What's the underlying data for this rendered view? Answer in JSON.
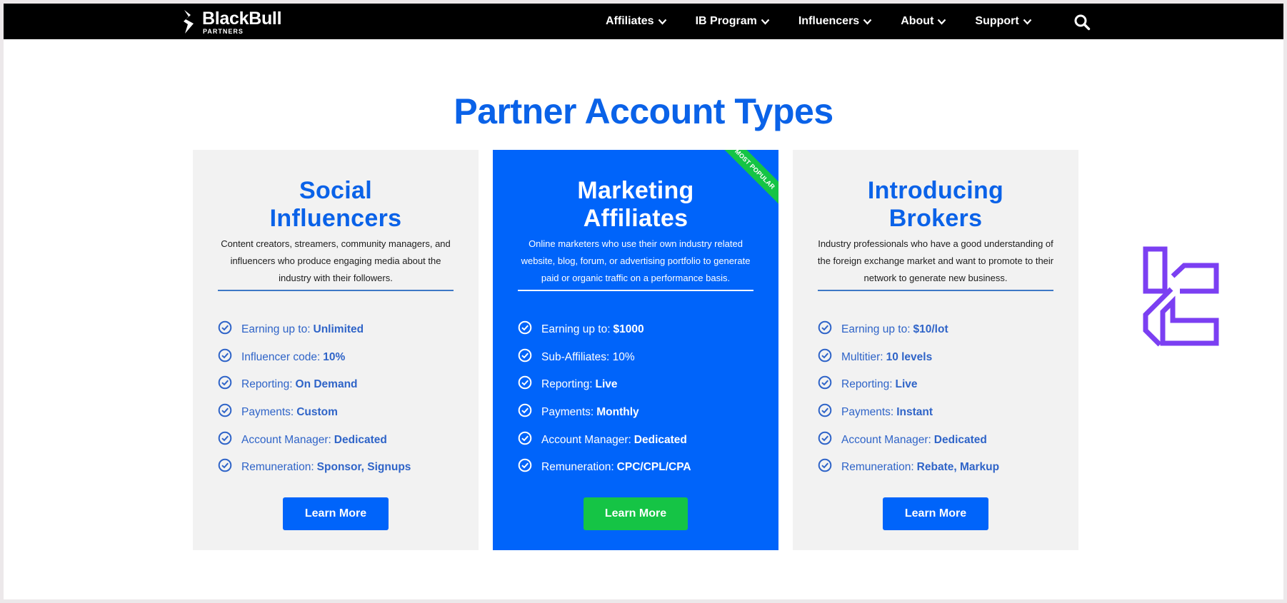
{
  "brand": {
    "name": "BlackBull",
    "subtitle": "PARTNERS"
  },
  "nav": {
    "items": [
      {
        "label": "Affiliates",
        "icon": "chevron-down-icon"
      },
      {
        "label": "IB Program",
        "icon": "chevron-down-icon"
      },
      {
        "label": "Influencers",
        "icon": "chevron-down-icon"
      },
      {
        "label": "About",
        "icon": "chevron-down-icon"
      },
      {
        "label": "Support",
        "icon": "chevron-down-icon"
      }
    ],
    "search_icon": "search-icon"
  },
  "page": {
    "title": "Partner Account Types"
  },
  "colors": {
    "brand_blue": "#0064fa",
    "title_blue": "#0a62e8",
    "accent_green": "#15c445",
    "card_bg": "#f2f2f2",
    "watermark_purple": "#7b3ff2"
  },
  "cards": [
    {
      "title_line1": "Social",
      "title_line2": "Influencers",
      "description": "Content creators, streamers, community managers, and influencers who produce engaging media about the industry with their followers.",
      "features": [
        {
          "label": "Earning up to:",
          "value": "Unlimited"
        },
        {
          "label": "Influencer code:",
          "value": "10%"
        },
        {
          "label": "Reporting:",
          "value": "On Demand"
        },
        {
          "label": "Payments:",
          "value": "Custom"
        },
        {
          "label": "Account Manager:",
          "value": "Dedicated"
        },
        {
          "label": "Remuneration:",
          "value": "Sponsor, Signups"
        }
      ],
      "button": "Learn More"
    },
    {
      "title_line1": "Marketing",
      "title_line2": "Affiliates",
      "badge": "MOST POPULAR",
      "description": "Online marketers who use their own industry related website, blog, forum, or advertising portfolio to generate paid or organic traffic on a performance basis.",
      "features": [
        {
          "label": "Earning up to:",
          "value": "$1000"
        },
        {
          "label": "Sub-Affiliates: 10%",
          "value": ""
        },
        {
          "label": "Reporting:",
          "value": "Live"
        },
        {
          "label": "Payments:",
          "value": "Monthly"
        },
        {
          "label": "Account Manager:",
          "value": "Dedicated"
        },
        {
          "label": "Remuneration:",
          "value": "CPC/CPL/CPA"
        }
      ],
      "button": "Learn More"
    },
    {
      "title_line1": "Introducing",
      "title_line2": "Brokers",
      "description": "Industry professionals who have a good understanding of the foreign exchange market and want to promote to their network to generate new business.",
      "features": [
        {
          "label": "Earning up to:",
          "value": "$10/lot"
        },
        {
          "label": "Multitier:",
          "value": "10 levels"
        },
        {
          "label": "Reporting:",
          "value": "Live"
        },
        {
          "label": "Payments:",
          "value": "Instant"
        },
        {
          "label": "Account Manager:",
          "value": "Dedicated"
        },
        {
          "label": "Remuneration:",
          "value": "Rebate, Markup"
        }
      ],
      "button": "Learn More"
    }
  ]
}
